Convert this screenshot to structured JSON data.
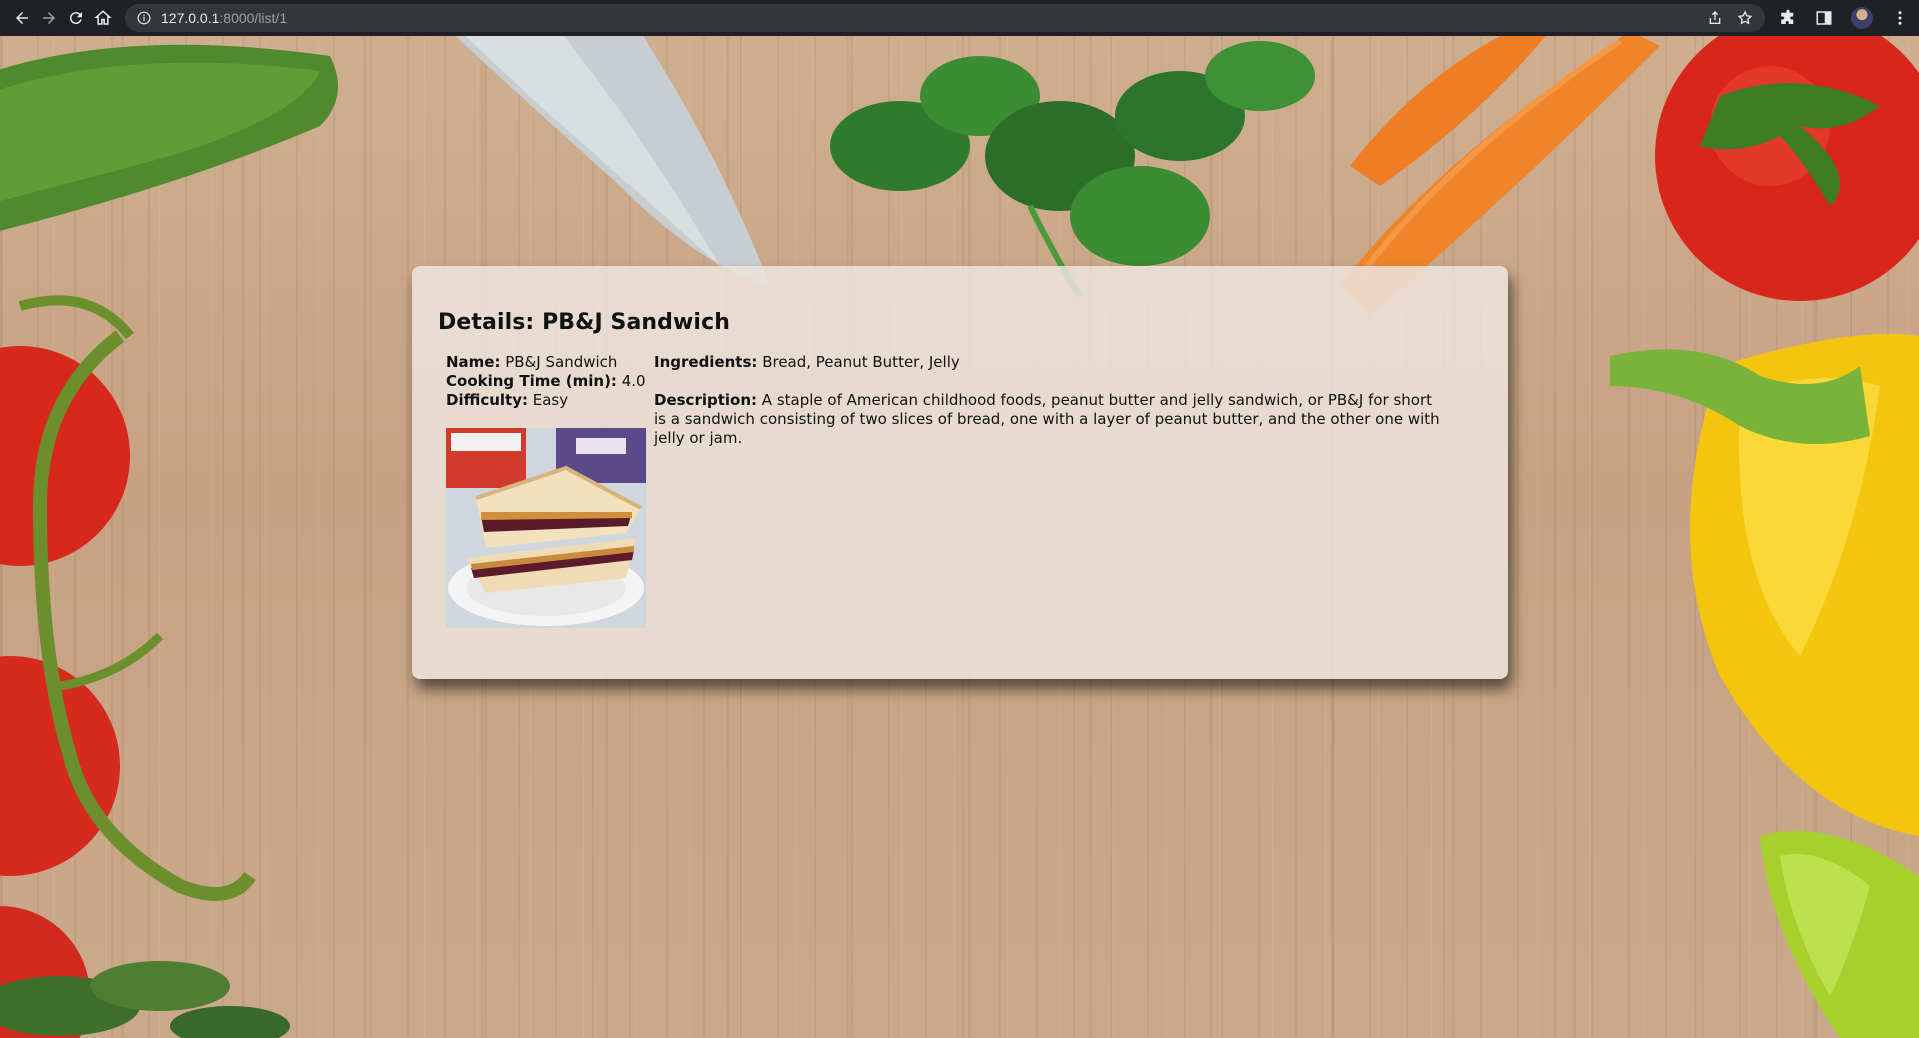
{
  "browser": {
    "url_host": "127.0.0.1",
    "url_path": ":8000/list/1"
  },
  "card": {
    "title": "Details: PB&J Sandwich",
    "name_label": "Name:",
    "name_value": "PB&J Sandwich",
    "cooking_label": "Cooking Time (min):",
    "cooking_value": "4.0",
    "difficulty_label": "Difficulty:",
    "difficulty_value": "Easy",
    "ingredients_label": "Ingredients:",
    "ingredients_value": "Bread, Peanut Butter, Jelly",
    "description_label": "Description:",
    "description_value": "A staple of American childhood foods, peanut butter and jelly sandwich, or PB&J for short is a sandwich consisting of two slices of bread, one with a layer of peanut butter, and the other one with jelly or jam."
  },
  "colors": {
    "chrome_bg": "#202124",
    "omnibox_bg": "#35363a",
    "card_bg": "#ece4dc"
  }
}
